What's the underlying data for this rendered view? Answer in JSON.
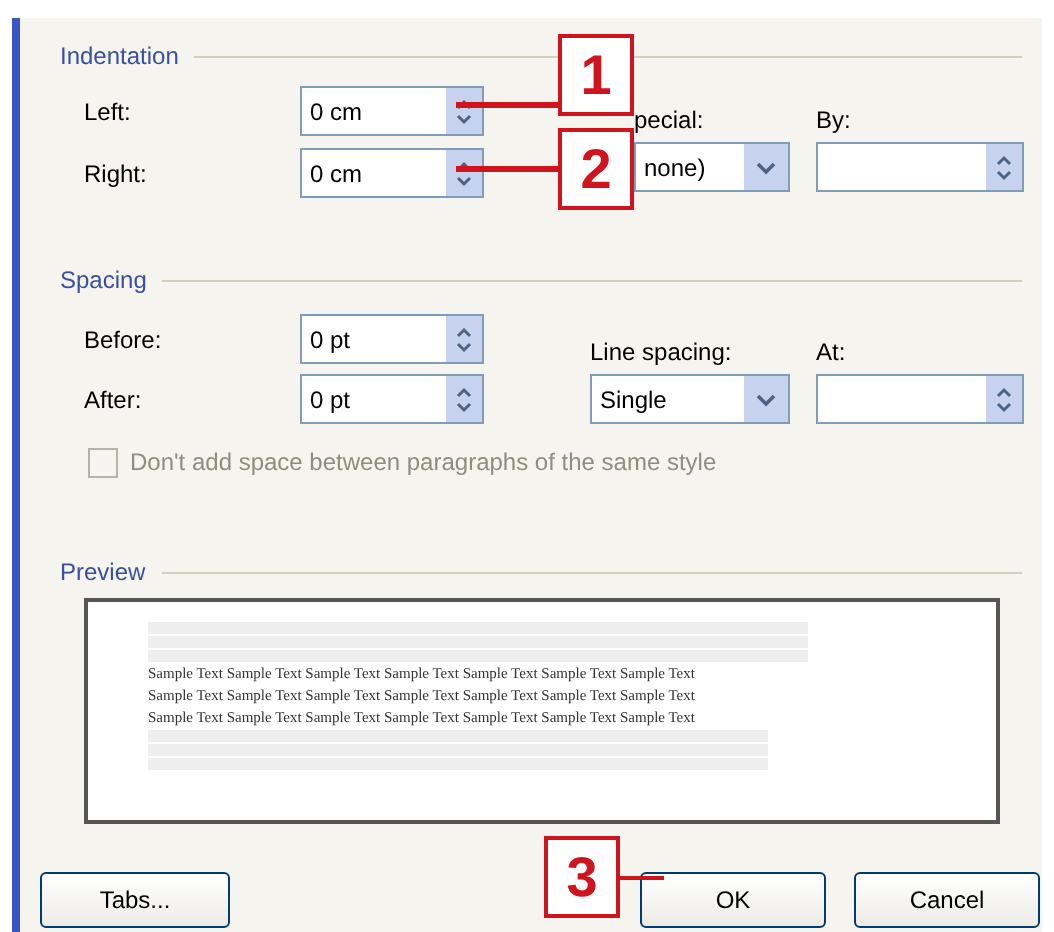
{
  "indentation": {
    "title": "Indentation",
    "left": {
      "label": "Left:",
      "value": "0 cm"
    },
    "right": {
      "label": "Right:",
      "value": "0 cm"
    },
    "special": {
      "label": "pecial:",
      "value": "none)"
    },
    "by": {
      "label": "By:"
    }
  },
  "spacing": {
    "title": "Spacing",
    "before": {
      "label": "Before:",
      "value": "0 pt"
    },
    "after": {
      "label": "After:",
      "value": "0 pt"
    },
    "line_spacing": {
      "label": "Line spacing:",
      "value": "Single"
    },
    "at": {
      "label": "At:"
    },
    "checkbox": {
      "label": "Don't add space between paragraphs of the same style",
      "checked": false,
      "disabled": true
    }
  },
  "preview": {
    "title": "Preview",
    "sample_lines": [
      "Sample Text Sample Text Sample Text Sample Text Sample Text Sample Text Sample Text",
      "Sample Text Sample Text Sample Text Sample Text Sample Text Sample Text Sample Text",
      "Sample Text Sample Text Sample Text Sample Text Sample Text Sample Text Sample Text"
    ]
  },
  "buttons": [
    {
      "label": "Tabs...",
      "kind": "tabs"
    },
    {
      "label": "OK",
      "kind": "ok"
    },
    {
      "label": "Cancel",
      "kind": "cancel"
    }
  ],
  "callouts": [
    "1",
    "2",
    "3"
  ]
}
